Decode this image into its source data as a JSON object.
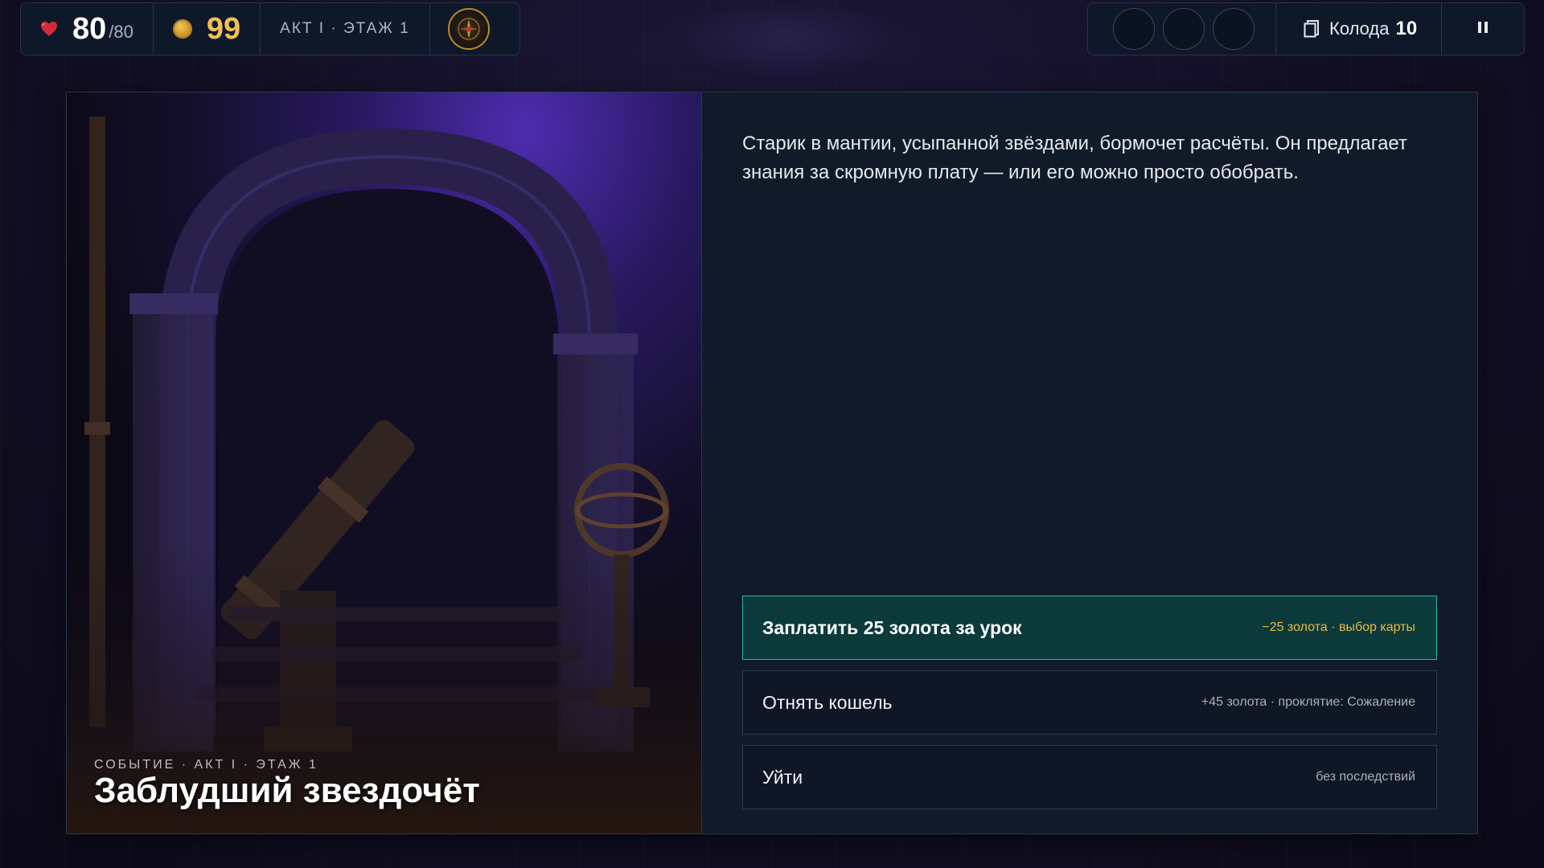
{
  "hud": {
    "hp": "80",
    "hp_max": "/80",
    "gold": "99",
    "location": "АКТ I · ЭТАЖ 1",
    "deck_label": "Колода",
    "deck_count": "10"
  },
  "event": {
    "tag": "СОБЫТИЕ · АКТ I · ЭТАЖ 1",
    "title": "Заблудший звездочёт",
    "description": "Старик в мантии, усыпанной звёздами, бормочет расчёты. Он предлагает знания за скромную плату — или его можно просто обобрать.",
    "choices": [
      {
        "label": "Заплатить 25 золота за урок",
        "effect": "−25 золота · выбор карты",
        "active": true
      },
      {
        "label": "Отнять кошель",
        "effect": "+45 золота · проклятие: Сожаление",
        "active": false
      },
      {
        "label": "Уйти",
        "effect": "без последствий",
        "active": false
      }
    ]
  },
  "colors": {
    "accent_teal": "#2bb7a6",
    "gold": "#f0c153",
    "heart": "#d42a3a",
    "panel_bg": "#111a29"
  },
  "icons": [
    "heart-icon",
    "coin-icon",
    "compass-icon",
    "deck-icon",
    "pause-icon"
  ]
}
